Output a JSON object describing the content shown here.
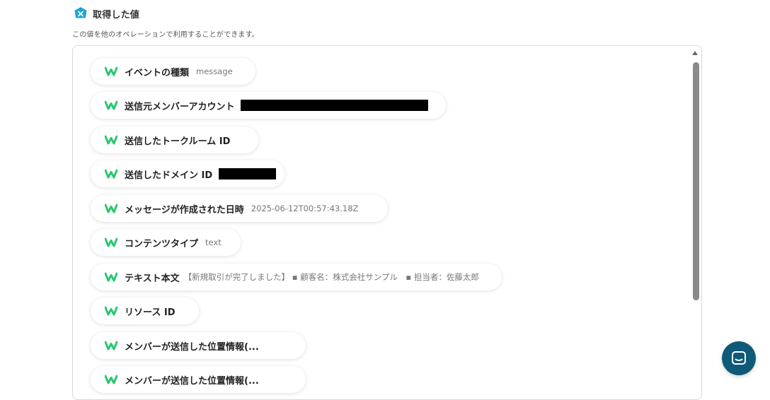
{
  "section": {
    "title": "取得した値",
    "icon": "hexagon-x-icon",
    "description": "この値を他のオペレーションで利用することができます。"
  },
  "items": [
    {
      "label": "イベントの種類",
      "value": "message"
    },
    {
      "label": "送信元メンバーアカウント",
      "value": "",
      "redacted": true
    },
    {
      "label": "送信したトークルーム ID",
      "value": ""
    },
    {
      "label": "送信したドメイン ID",
      "value": "",
      "redacted": true
    },
    {
      "label": "メッセージが作成された日時",
      "value": "2025-06-12T00:57:43.18Z"
    },
    {
      "label": "コンテンツタイプ",
      "value": "text"
    },
    {
      "label": "テキスト本文",
      "value": "【新規取引が完了しました】 ▪ 顧客名：株式会社サンプル　▪ 担当者：佐藤太郎"
    },
    {
      "label": "リソース ID",
      "value": ""
    },
    {
      "label": "メンバーが送信した位置情報(...",
      "value": ""
    },
    {
      "label": "メンバーが送信した位置情報(...",
      "value": ""
    }
  ],
  "colors": {
    "accent": "#1aa3d9",
    "app_icon_green": "#28c76f",
    "chat_button": "#0e5a78",
    "scrollbar": "#8a8a8a"
  },
  "widgets": {
    "app_icon": "worksmobile-w-icon",
    "chat_icon": "chat-bubble-icon"
  }
}
